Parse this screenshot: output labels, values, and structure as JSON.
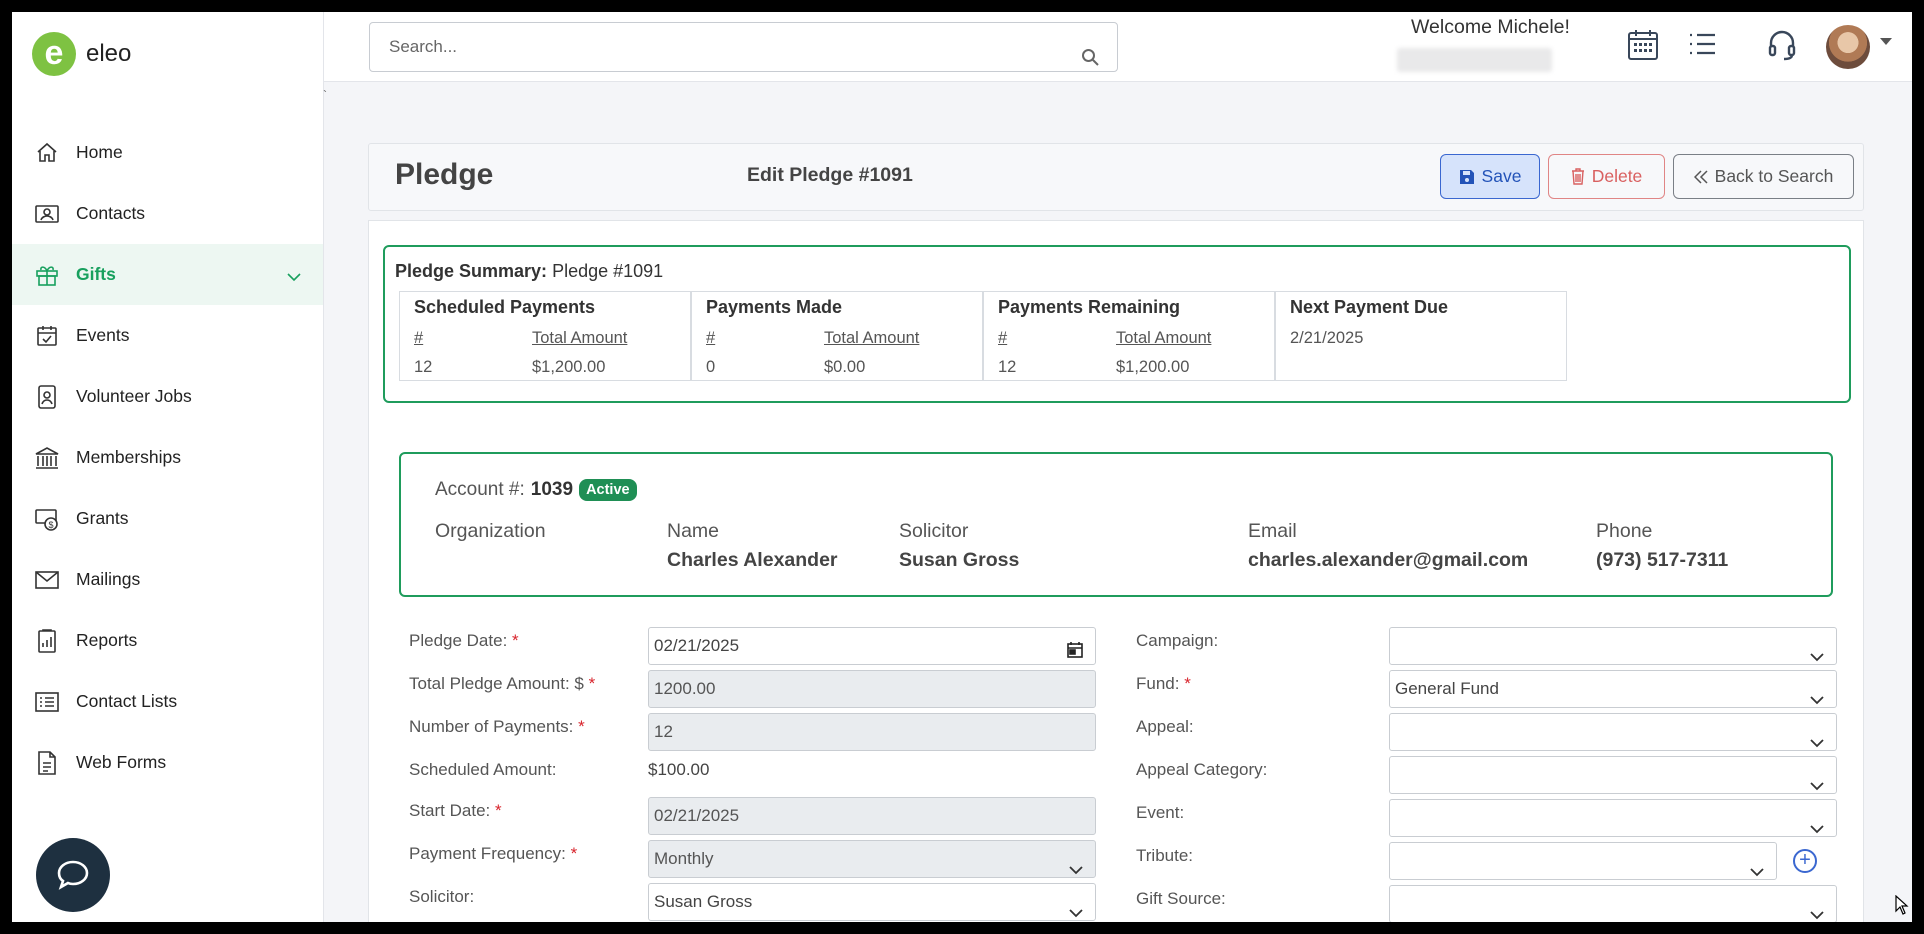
{
  "app": {
    "logo_text": "eleo"
  },
  "sidebar": {
    "items": [
      {
        "label": "Home",
        "icon": "home-icon"
      },
      {
        "label": "Contacts",
        "icon": "contacts-icon"
      },
      {
        "label": "Gifts",
        "icon": "gift-icon",
        "active": true
      },
      {
        "label": "Events",
        "icon": "calendar-check-icon"
      },
      {
        "label": "Volunteer Jobs",
        "icon": "id-badge-icon"
      },
      {
        "label": "Memberships",
        "icon": "bank-icon"
      },
      {
        "label": "Grants",
        "icon": "money-icon"
      },
      {
        "label": "Mailings",
        "icon": "envelope-icon"
      },
      {
        "label": "Reports",
        "icon": "report-icon"
      },
      {
        "label": "Contact Lists",
        "icon": "list-icon"
      },
      {
        "label": "Web Forms",
        "icon": "form-icon"
      }
    ]
  },
  "topbar": {
    "search_placeholder": "Search...",
    "welcome": "Welcome Michele!"
  },
  "header": {
    "title": "Pledge",
    "subtitle": "Edit Pledge #1091",
    "save_label": "Save",
    "delete_label": "Delete",
    "back_label": "Back to Search"
  },
  "summary": {
    "label": "Pledge Summary:",
    "value": "Pledge #1091",
    "scheduled": {
      "title": "Scheduled Payments",
      "count_header": "#",
      "amount_header": "Total Amount",
      "count": "12",
      "amount": "$1,200.00"
    },
    "made": {
      "title": "Payments Made",
      "count_header": "#",
      "amount_header": "Total Amount",
      "count": "0",
      "amount": "$0.00"
    },
    "remaining": {
      "title": "Payments Remaining",
      "count_header": "#",
      "amount_header": "Total Amount",
      "count": "12",
      "amount": "$1,200.00"
    },
    "next_due": {
      "title": "Next Payment Due",
      "date": "2/21/2025"
    }
  },
  "account": {
    "label": "Account #:",
    "number": "1039",
    "status": "Active",
    "organization_label": "Organization",
    "name_label": "Name",
    "name": "Charles Alexander",
    "solicitor_label": "Solicitor",
    "solicitor": "Susan Gross",
    "email_label": "Email",
    "email": "charles.alexander@gmail.com",
    "phone_label": "Phone",
    "phone": "(973) 517-7311"
  },
  "form": {
    "pledge_date_label": "Pledge Date:",
    "pledge_date": "02/21/2025",
    "total_amount_label": "Total Pledge Amount: $",
    "total_amount": "1200.00",
    "num_payments_label": "Number of Payments:",
    "num_payments": "12",
    "scheduled_amount_label": "Scheduled Amount:",
    "scheduled_amount": "$100.00",
    "start_date_label": "Start Date:",
    "start_date": "02/21/2025",
    "frequency_label": "Payment Frequency:",
    "frequency": "Monthly",
    "solicitor_label": "Solicitor:",
    "solicitor": "Susan Gross",
    "campaign_label": "Campaign:",
    "campaign": "",
    "fund_label": "Fund:",
    "fund": "General Fund",
    "appeal_label": "Appeal:",
    "appeal": "",
    "appeal_category_label": "Appeal Category:",
    "appeal_category": "",
    "event_label": "Event:",
    "event": "",
    "tribute_label": "Tribute:",
    "tribute": "",
    "gift_source_label": "Gift Source:",
    "gift_source": "",
    "required_mark": "*"
  },
  "colors": {
    "accent_green": "#1f9c5c",
    "primary_blue": "#3a67d0",
    "danger": "#d96060"
  }
}
